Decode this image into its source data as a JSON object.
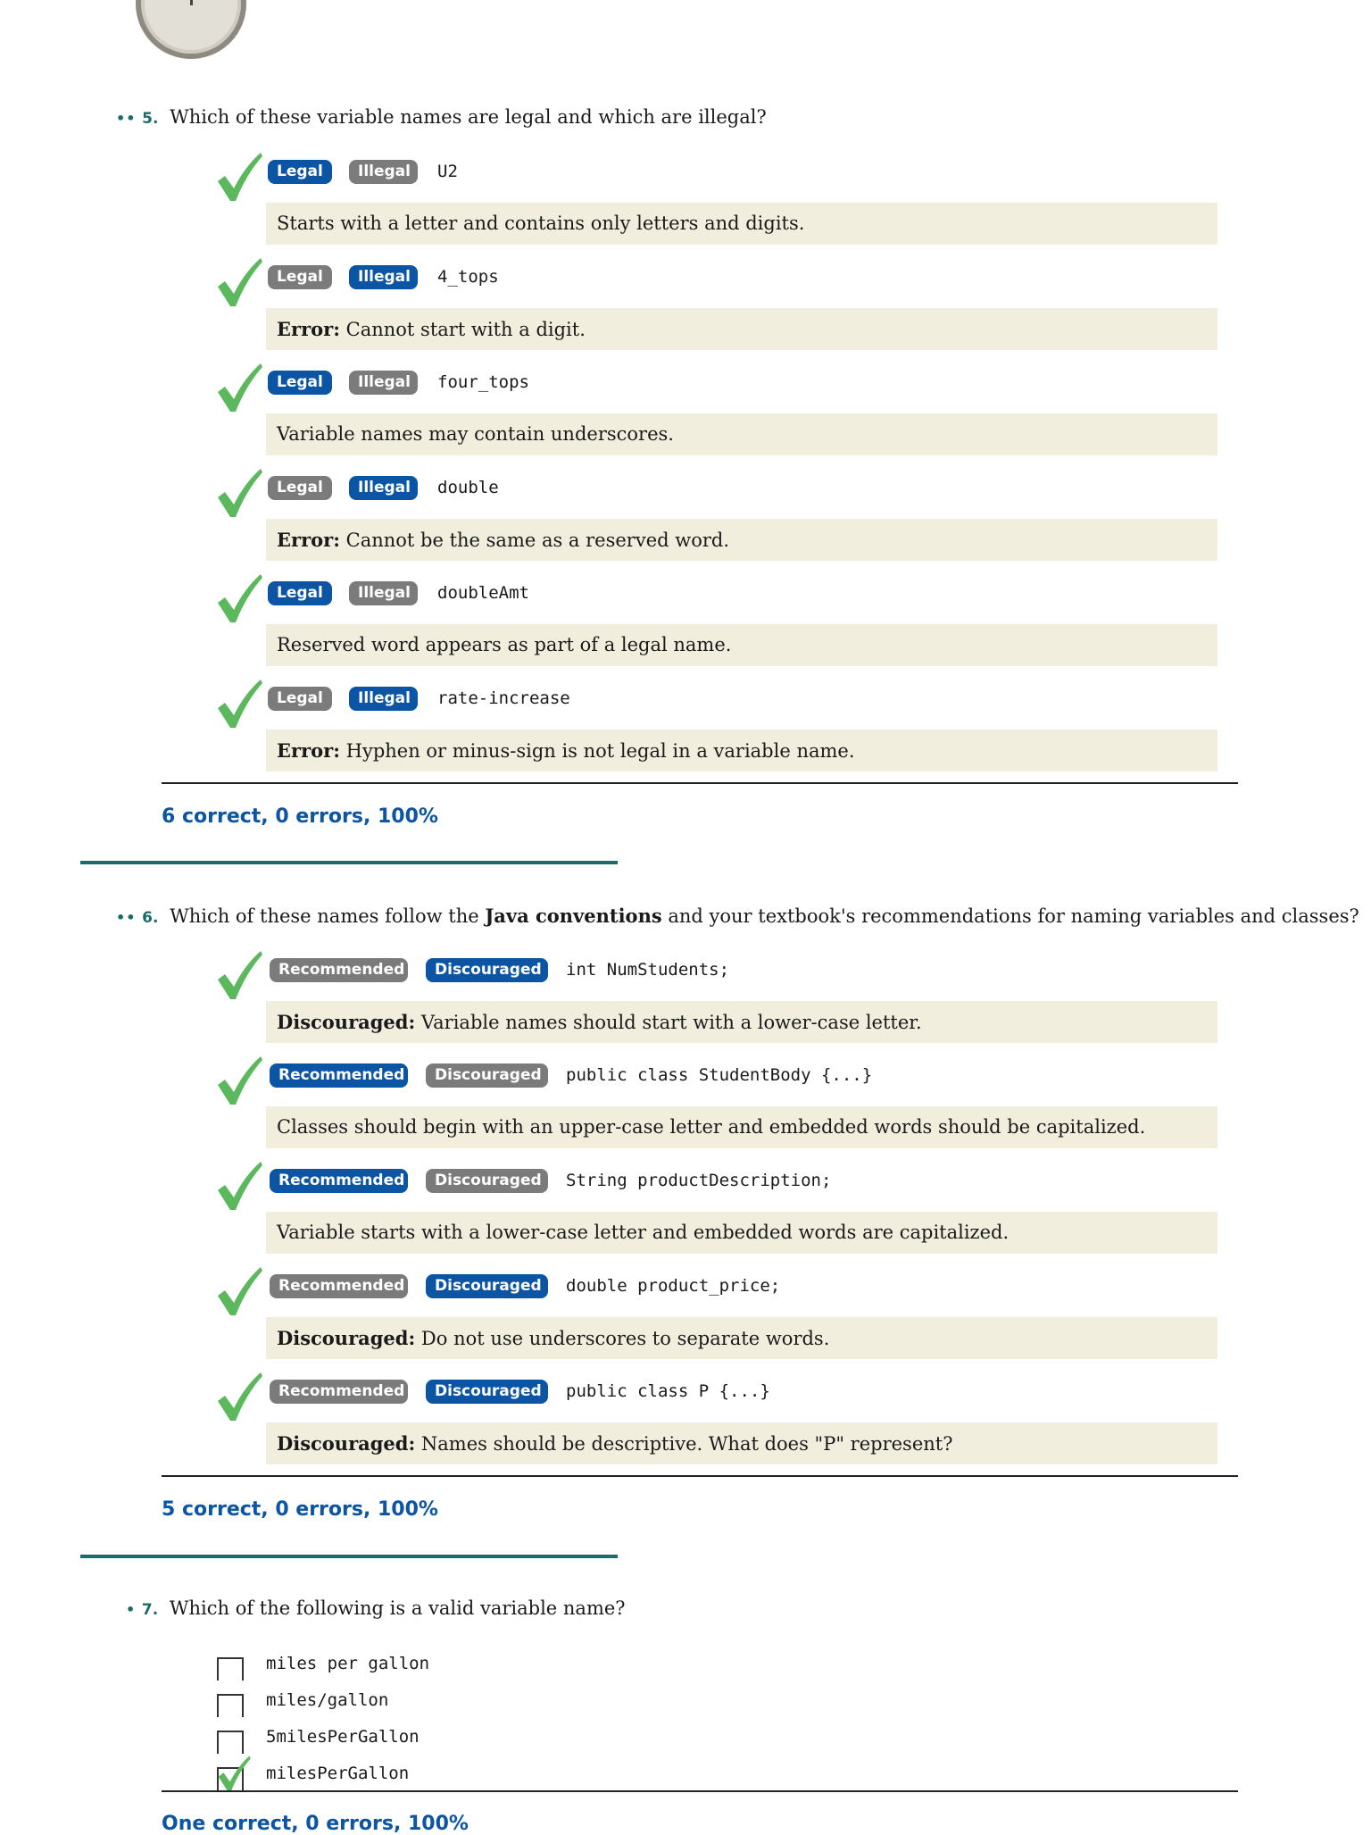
{
  "q5": {
    "dots": "••",
    "number": "5.",
    "text": "Which of these variable names are legal and which are illegal?",
    "options": [
      "Legal",
      "Illegal"
    ],
    "items": [
      {
        "code": "U2",
        "selected": "Legal",
        "feedback_bold": "",
        "feedback": "Starts with a letter and contains only letters and digits."
      },
      {
        "code": "4_tops",
        "selected": "Illegal",
        "feedback_bold": "Error:",
        "feedback": " Cannot start with a digit."
      },
      {
        "code": "four_tops",
        "selected": "Legal",
        "feedback_bold": "",
        "feedback": "Variable names may contain underscores."
      },
      {
        "code": "double",
        "selected": "Illegal",
        "feedback_bold": "Error:",
        "feedback": " Cannot be the same as a reserved word."
      },
      {
        "code": "doubleAmt",
        "selected": "Legal",
        "feedback_bold": "",
        "feedback": "Reserved word appears as part of a legal name."
      },
      {
        "code": "rate-increase",
        "selected": "Illegal",
        "feedback_bold": "Error:",
        "feedback": " Hyphen or minus-sign is not legal in a variable name."
      }
    ],
    "score": "6 correct, 0 errors, 100%"
  },
  "q6": {
    "dots": "••",
    "number": "6.",
    "text_pre": "Which of these names follow the ",
    "text_bold": "Java conventions",
    "text_post": " and your textbook's recommendations for naming variables and classes?",
    "options": [
      "Recommended",
      "Discouraged"
    ],
    "items": [
      {
        "code": "int NumStudents;",
        "selected": "Discouraged",
        "feedback_bold": "Discouraged:",
        "feedback": " Variable names should start with a lower-case letter."
      },
      {
        "code": "public class StudentBody {...}",
        "selected": "Recommended",
        "feedback_bold": "",
        "feedback": "Classes should begin with an upper-case letter and embedded words should be capitalized."
      },
      {
        "code": "String productDescription;",
        "selected": "Recommended",
        "feedback_bold": "",
        "feedback": "Variable starts with a lower-case letter and embedded words are capitalized."
      },
      {
        "code": "double product_price;",
        "selected": "Discouraged",
        "feedback_bold": "Discouraged:",
        "feedback": " Do not use underscores to separate words."
      },
      {
        "code": "public class P {...}",
        "selected": "Discouraged",
        "feedback_bold": "Discouraged:",
        "feedback": " Names should be descriptive. What does \"P\" represent?"
      }
    ],
    "score": "5 correct, 0 errors, 100%"
  },
  "q7": {
    "dots": "•",
    "number": "7.",
    "text": "Which of the following is a valid variable name?",
    "choices": [
      {
        "label": "miles per gallon",
        "checked": false
      },
      {
        "label": "miles/gallon",
        "checked": false
      },
      {
        "label": "5milesPerGallon",
        "checked": false
      },
      {
        "label": "milesPerGallon",
        "checked": true
      }
    ],
    "score": "One correct, 0 errors, 100%"
  },
  "colors": {
    "selected": "#0b55a4",
    "unselected": "#7b7b7b",
    "feedback_bg": "#f1eedd",
    "accent": "#1b6b6b",
    "check": "#5cb85c"
  }
}
